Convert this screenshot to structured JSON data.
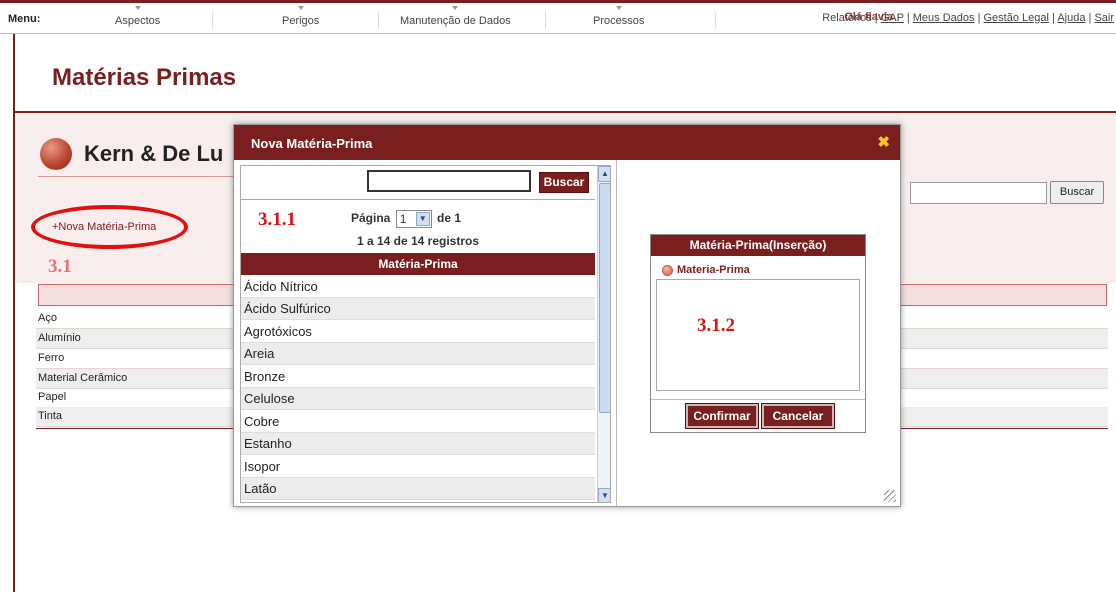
{
  "topbar": {
    "menu_label": "Menu:",
    "items": [
      "Aspectos",
      "Perigos",
      "Manutenção de Dados",
      "Processos"
    ],
    "user_overlap_text": "Olá flavia",
    "relatorios_label": "Relatórios",
    "links": [
      "GAP",
      "Meus Dados",
      "Gestão Legal",
      "Ajuda",
      "Sair"
    ]
  },
  "page": {
    "title": "Matérias Primas",
    "company_name": "Kern & De Lu",
    "search_button": "Buscar",
    "new_link": "+Nova Matéria-Prima",
    "annotation_main": "3.1",
    "rows": [
      "Aço",
      "Alumínio",
      "Ferro",
      "Material Cerâmico",
      "Papel",
      "Tinta"
    ]
  },
  "modal": {
    "title": "Nova Matéria-Prima",
    "close_icon": "close-icon",
    "search_button": "Buscar",
    "pagination": {
      "label": "Página",
      "current": "1",
      "of_label": "de 1",
      "records": "1 a 14 de 14 registros"
    },
    "annotation_list": "3.1.1",
    "column_header": "Matéria-Prima",
    "list_items": [
      "Ácido Nítrico",
      "Ácido Sulfúrico",
      "Agrotóxicos",
      "Areia",
      "Bronze",
      "Celulose",
      "Cobre",
      "Estanho",
      "Isopor",
      "Latão"
    ],
    "insert_panel": {
      "header": "Matéria-Prima(Inserção)",
      "field_label": "Materia-Prima",
      "annotation": "3.1.2",
      "confirm_button": "Confirmar",
      "cancel_button": "Cancelar"
    }
  },
  "colors": {
    "brand": "#7a1f1f",
    "annotation": "#e01010",
    "close_icon": "#f2c12e"
  }
}
